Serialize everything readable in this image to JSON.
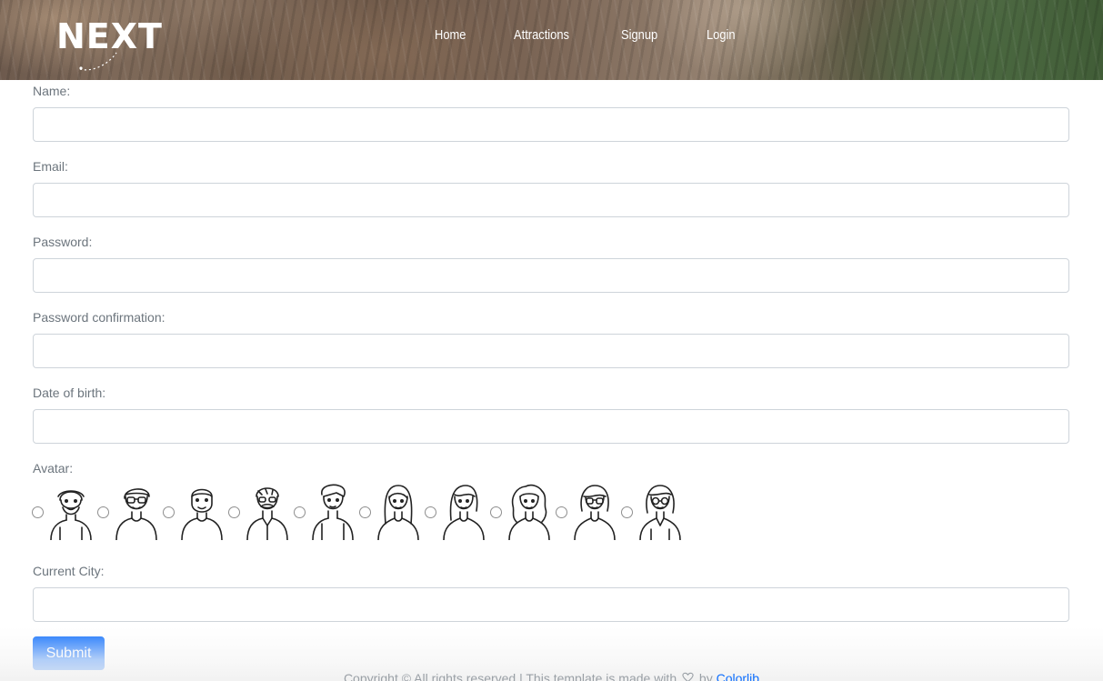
{
  "header": {
    "logo_text": "NEXT",
    "nav": [
      {
        "label": "Home"
      },
      {
        "label": "Attractions"
      },
      {
        "label": "Signup"
      },
      {
        "label": "Login"
      }
    ]
  },
  "form": {
    "name_label": "Name:",
    "name_value": "",
    "email_label": "Email:",
    "email_value": "",
    "password_label": "Password:",
    "password_value": "",
    "password_confirmation_label": "Password confirmation:",
    "password_confirmation_value": "",
    "dob_label": "Date of birth:",
    "dob_value": "",
    "avatar_label": "Avatar:",
    "avatars": [
      {
        "icon": "old-man-beard-avatar-icon"
      },
      {
        "icon": "man-glasses-avatar-icon"
      },
      {
        "icon": "man-beard-avatar-icon"
      },
      {
        "icon": "man-mustache-avatar-icon"
      },
      {
        "icon": "young-man-avatar-icon"
      },
      {
        "icon": "woman-long-hair-avatar-icon"
      },
      {
        "icon": "woman-side-hair-avatar-icon"
      },
      {
        "icon": "woman-curly-hair-avatar-icon"
      },
      {
        "icon": "woman-glasses-avatar-icon"
      },
      {
        "icon": "woman-glasses-bob-avatar-icon"
      }
    ],
    "city_label": "Current City:",
    "city_value": "",
    "submit_label": "Submit"
  },
  "footer": {
    "text_before": "Copyright © All rights reserved | This template is made with",
    "text_by": "by",
    "link_text": "Colorlib"
  },
  "colors": {
    "primary": "#0d6efd",
    "label": "#6c757d",
    "input_border": "#ced4da"
  }
}
